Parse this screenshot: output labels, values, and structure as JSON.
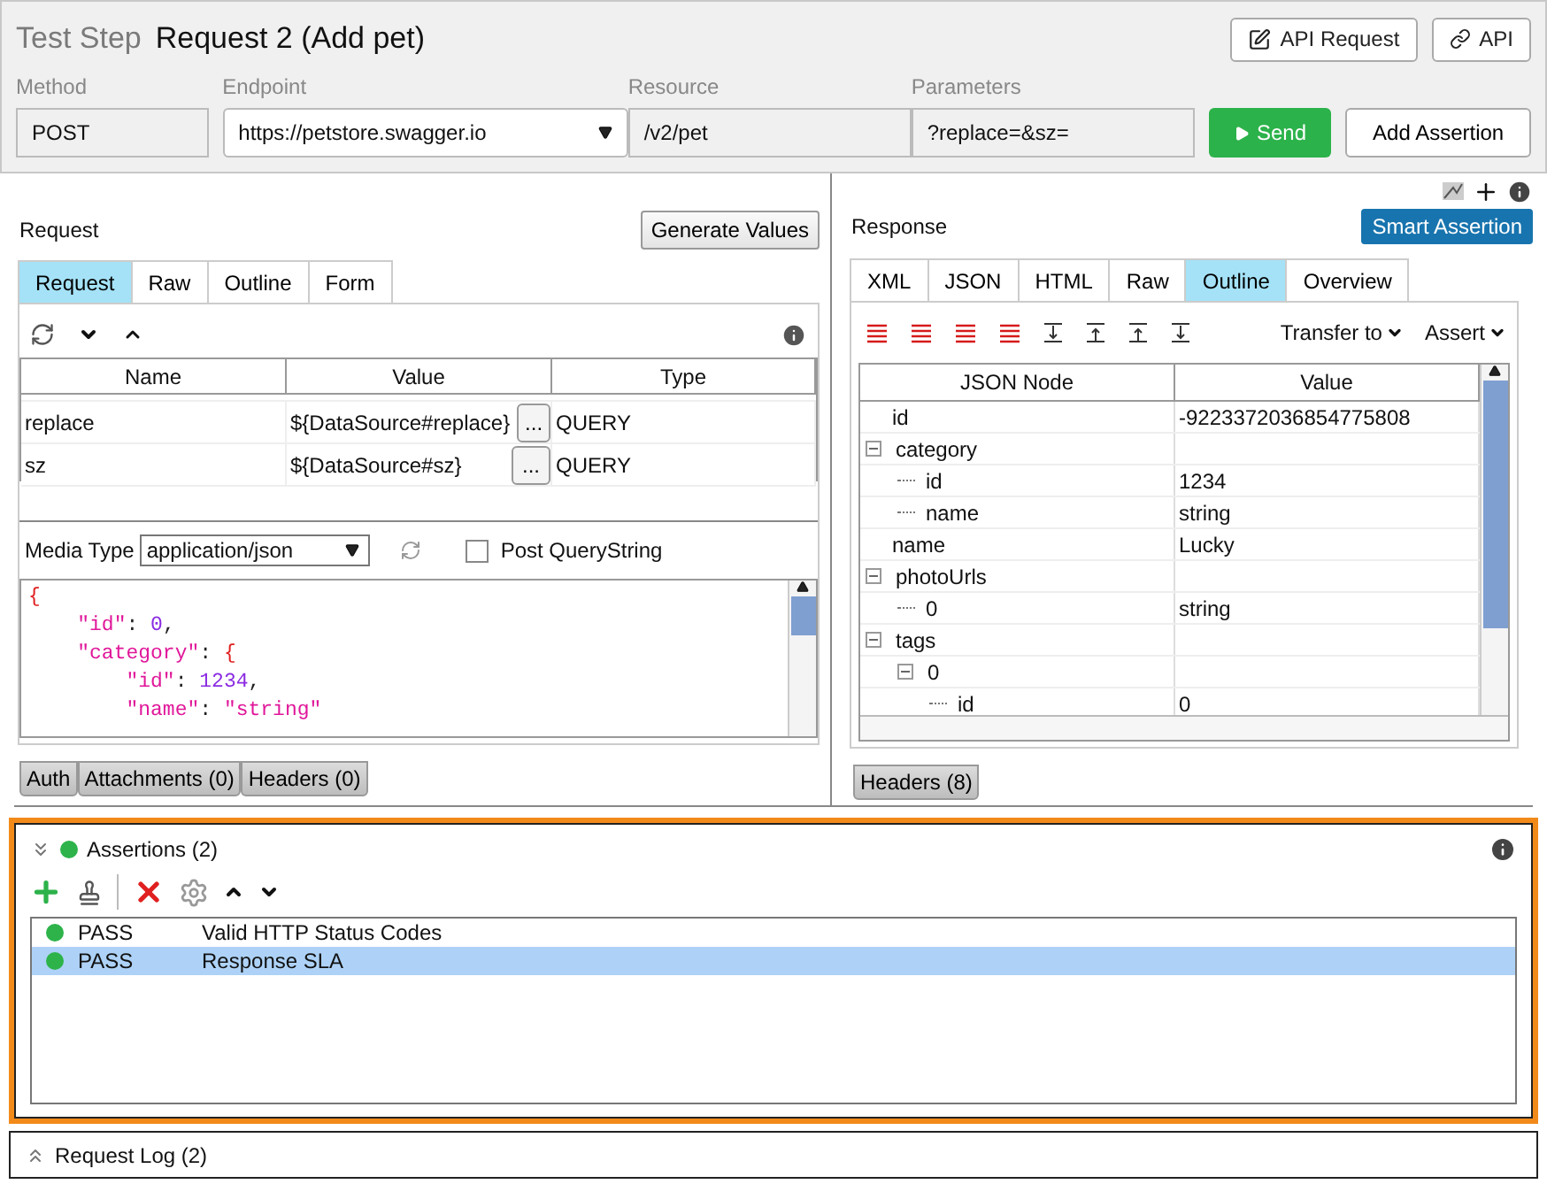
{
  "header": {
    "caption": "Test Step",
    "title": "Request 2 (Add pet)",
    "buttons": [
      {
        "kind": "edit",
        "label": "API Request"
      },
      {
        "kind": "link",
        "label": "API"
      }
    ]
  },
  "fields": {
    "method": {
      "label": "Method",
      "value": "POST"
    },
    "endpoint": {
      "label": "Endpoint",
      "value": "https://petstore.swagger.io"
    },
    "resource": {
      "label": "Resource",
      "value": "/v2/pet"
    },
    "parameters": {
      "label": "Parameters",
      "value": "?replace=&sz="
    }
  },
  "send_button": "Send",
  "add_assertion_button": "Add Assertion",
  "request": {
    "title": "Request",
    "generate_button": "Generate Values",
    "tabs": [
      {
        "label": "Request",
        "selected": true
      },
      {
        "label": "Raw",
        "selected": false
      },
      {
        "label": "Outline",
        "selected": false
      },
      {
        "label": "Form",
        "selected": false
      }
    ],
    "table": {
      "columns": [
        "Name",
        "Value",
        "Type"
      ],
      "rows": [
        {
          "name": "replace",
          "value": "${DataSource#replace}",
          "button": "...",
          "type": "QUERY"
        },
        {
          "name": "sz",
          "value": "${DataSource#sz}",
          "button": "...",
          "type": "QUERY"
        }
      ]
    },
    "media_type": {
      "label": "Media Type",
      "value": "application/json"
    },
    "post_querystring": {
      "label": "Post QueryString",
      "checked": false
    },
    "body_lines": [
      "{",
      "    \"id\": 0,",
      "    \"category\": {",
      "        \"id\": 1234,",
      "        \"name\": \"string\""
    ],
    "bottom_tabs": [
      "Auth",
      "Attachments (0)",
      "Headers (0)"
    ]
  },
  "response": {
    "title": "Response",
    "smart_assertion_button": "Smart Assertion",
    "tabs": [
      {
        "label": "XML",
        "selected": false
      },
      {
        "label": "JSON",
        "selected": false
      },
      {
        "label": "HTML",
        "selected": false
      },
      {
        "label": "Raw",
        "selected": false
      },
      {
        "label": "Outline",
        "selected": true
      },
      {
        "label": "Overview",
        "selected": false
      }
    ],
    "menus": [
      "Transfer to",
      "Assert"
    ],
    "tree": {
      "columns": [
        "JSON Node",
        "Value"
      ],
      "nodes": [
        {
          "name": "id",
          "value": "-9223372036854775808"
        },
        {
          "name": "category",
          "expanded": true,
          "children": [
            {
              "name": "id",
              "value": "1234"
            },
            {
              "name": "name",
              "value": "string"
            }
          ]
        },
        {
          "name": "name",
          "value": "Lucky"
        },
        {
          "name": "photoUrls",
          "expanded": true,
          "children": [
            {
              "name": "0",
              "value": "string"
            }
          ]
        },
        {
          "name": "tags",
          "expanded": true,
          "children": [
            {
              "name": "0",
              "expanded": true,
              "children": [
                {
                  "name": "id",
                  "value": "0"
                }
              ]
            }
          ]
        }
      ]
    },
    "bottom_tabs": [
      "Headers (8)"
    ]
  },
  "assertions": {
    "title": "Assertions (2)",
    "color": "#2db34a",
    "rows": [
      {
        "status": "PASS",
        "name": "Valid HTTP Status Codes",
        "color": "#2db34a",
        "selected": false
      },
      {
        "status": "PASS",
        "name": "Response SLA",
        "color": "#2db34a",
        "selected": true
      }
    ]
  },
  "request_log": {
    "title": "Request Log (2)"
  }
}
